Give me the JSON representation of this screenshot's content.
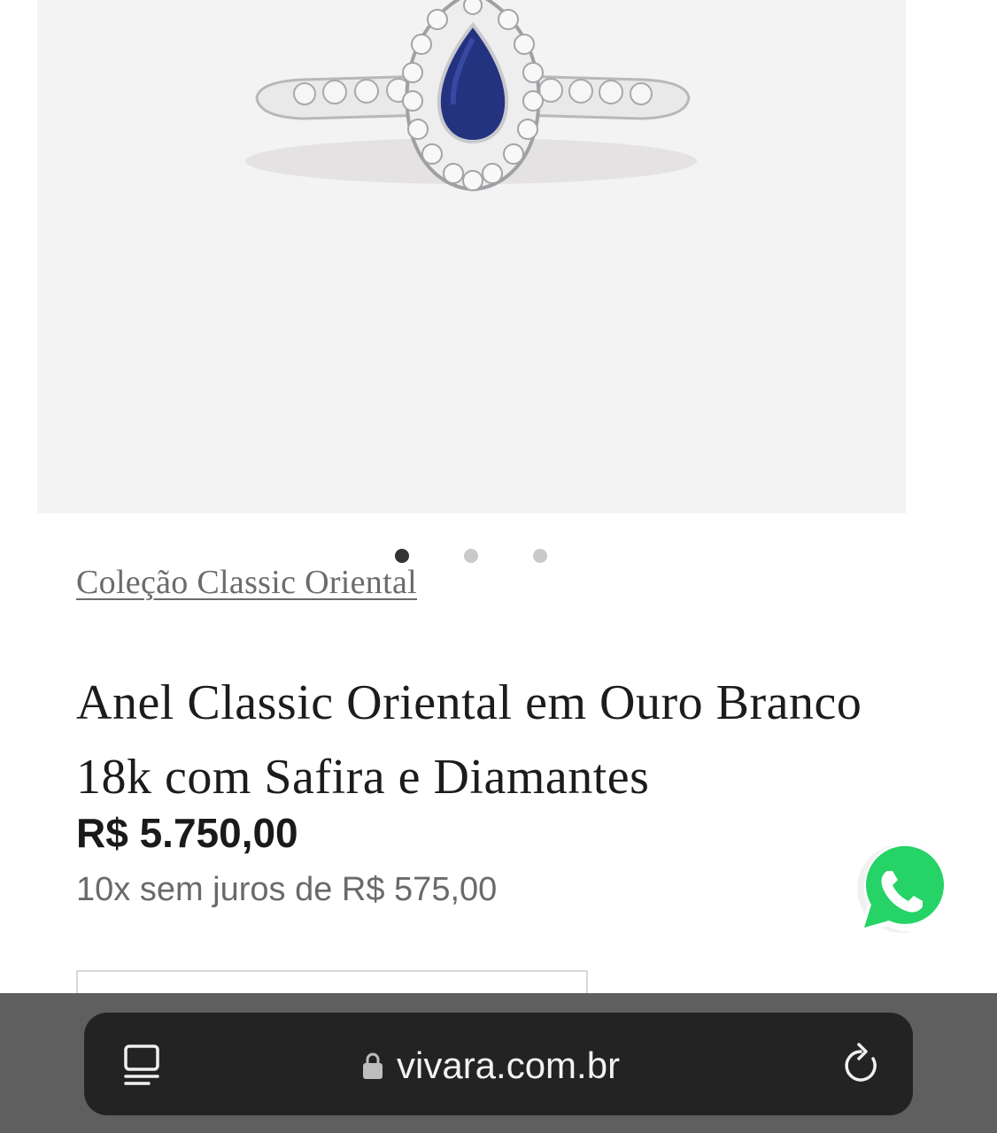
{
  "product": {
    "collection": "Coleção Classic Oriental",
    "title": "Anel Classic Oriental em Ouro Branco 18k com Safira e Diamantes",
    "price": "R$ 5.750,00",
    "installments": "10x sem juros de R$ 575,00"
  },
  "carousel": {
    "total_slides": 3,
    "active_slide": 1
  },
  "browser": {
    "url": "vivara.com.br"
  },
  "icons": {
    "tabs": "tabs-icon",
    "lock": "lock-icon",
    "reload": "reload-icon",
    "whatsapp": "whatsapp-icon"
  },
  "colors": {
    "image_background": "#f4f3f3",
    "gem": "#24337f",
    "whatsapp": "#25d366",
    "browser_bar": "#5f5f5f",
    "address_pill": "#232323"
  }
}
